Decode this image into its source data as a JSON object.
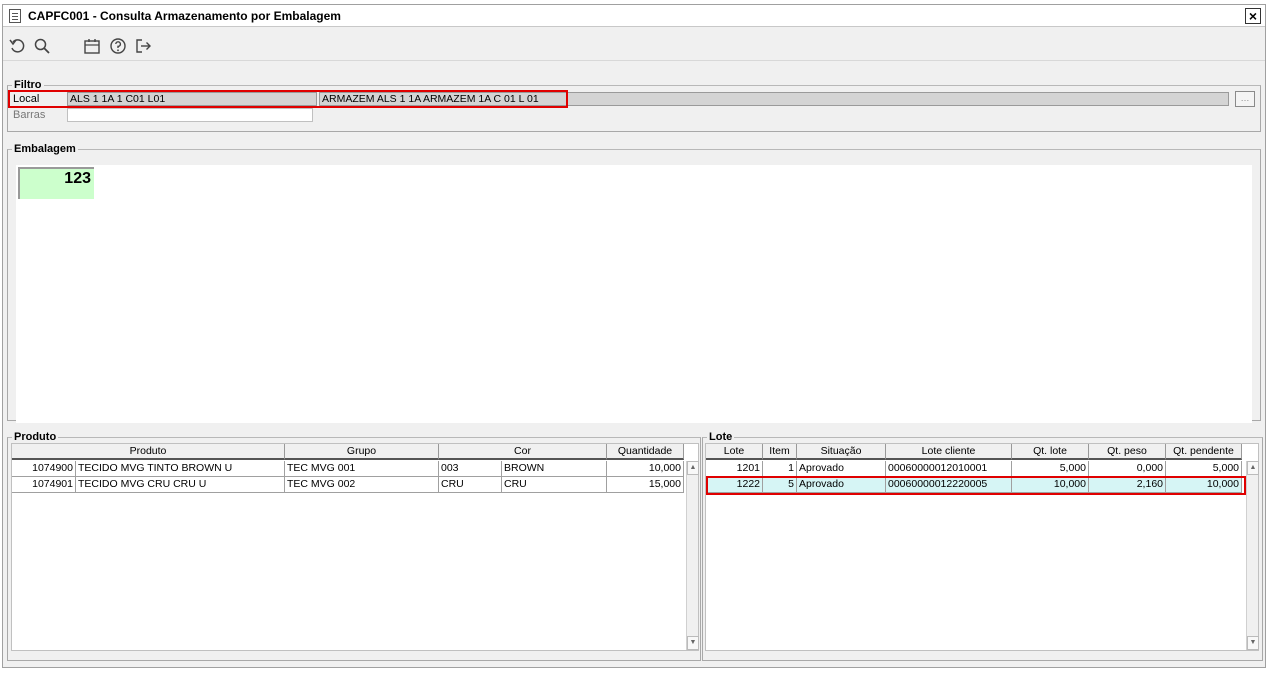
{
  "window": {
    "title": "CAPFC001 - Consulta Armazenamento por Embalagem",
    "close_label": "✕"
  },
  "toolbar": {
    "icons": [
      "undo-icon",
      "search-icon",
      "calendar-icon",
      "help-icon",
      "exit-icon"
    ]
  },
  "filtro": {
    "legend": "Filtro",
    "local_label": "Local",
    "local_value": "ALS 1 1A 1 C01 L01",
    "local_description": "ARMAZEM ALS 1 1A ARMAZEM 1A C 01 L 01",
    "barras_label": "Barras",
    "barras_value": "",
    "lookup_label": "…"
  },
  "embalagem": {
    "legend": "Embalagem",
    "tile_value": "123",
    "tile_color": "#ccffcc"
  },
  "produto": {
    "legend": "Produto",
    "headers": [
      "Produto",
      "Grupo",
      "Cor",
      "Quantidade"
    ],
    "rows": [
      {
        "codigo": "1074900",
        "descricao": "TECIDO MVG TINTO BROWN U",
        "grupo": "TEC MVG 001",
        "cor_cod": "003",
        "cor": "BROWN",
        "quantidade": "10,000"
      },
      {
        "codigo": "1074901",
        "descricao": "TECIDO MVG CRU CRU U",
        "grupo": "TEC MVG 002",
        "cor_cod": "CRU",
        "cor": "CRU",
        "quantidade": "15,000"
      }
    ]
  },
  "lote": {
    "legend": "Lote",
    "headers": [
      "Lote",
      "Item",
      "Situação",
      "Lote cliente",
      "Qt. lote",
      "Qt. peso",
      "Qt. pendente"
    ],
    "rows": [
      {
        "lote": "1201",
        "item": "1",
        "situacao": "Aprovado",
        "lote_cliente": "00060000012010001",
        "qt_lote": "5,000",
        "qt_peso": "0,000",
        "qt_pendente": "5,000"
      },
      {
        "lote": "1222",
        "item": "5",
        "situacao": "Aprovado",
        "lote_cliente": "00060000012220005",
        "qt_lote": "10,000",
        "qt_peso": "2,160",
        "qt_pendente": "10,000"
      }
    ]
  },
  "colors": {
    "highlight_border": "#e00000",
    "selected_row": "#d6f5f5"
  }
}
